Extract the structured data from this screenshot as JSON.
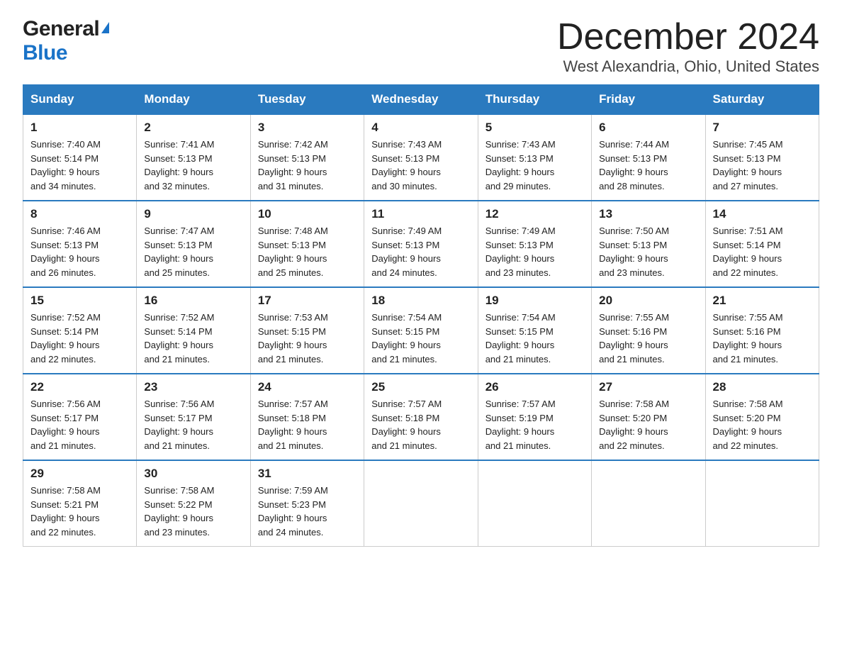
{
  "logo": {
    "general": "General",
    "blue": "Blue"
  },
  "title": "December 2024",
  "location": "West Alexandria, Ohio, United States",
  "days_of_week": [
    "Sunday",
    "Monday",
    "Tuesday",
    "Wednesday",
    "Thursday",
    "Friday",
    "Saturday"
  ],
  "weeks": [
    [
      {
        "day": "1",
        "sunrise": "7:40 AM",
        "sunset": "5:14 PM",
        "daylight": "9 hours and 34 minutes."
      },
      {
        "day": "2",
        "sunrise": "7:41 AM",
        "sunset": "5:13 PM",
        "daylight": "9 hours and 32 minutes."
      },
      {
        "day": "3",
        "sunrise": "7:42 AM",
        "sunset": "5:13 PM",
        "daylight": "9 hours and 31 minutes."
      },
      {
        "day": "4",
        "sunrise": "7:43 AM",
        "sunset": "5:13 PM",
        "daylight": "9 hours and 30 minutes."
      },
      {
        "day": "5",
        "sunrise": "7:43 AM",
        "sunset": "5:13 PM",
        "daylight": "9 hours and 29 minutes."
      },
      {
        "day": "6",
        "sunrise": "7:44 AM",
        "sunset": "5:13 PM",
        "daylight": "9 hours and 28 minutes."
      },
      {
        "day": "7",
        "sunrise": "7:45 AM",
        "sunset": "5:13 PM",
        "daylight": "9 hours and 27 minutes."
      }
    ],
    [
      {
        "day": "8",
        "sunrise": "7:46 AM",
        "sunset": "5:13 PM",
        "daylight": "9 hours and 26 minutes."
      },
      {
        "day": "9",
        "sunrise": "7:47 AM",
        "sunset": "5:13 PM",
        "daylight": "9 hours and 25 minutes."
      },
      {
        "day": "10",
        "sunrise": "7:48 AM",
        "sunset": "5:13 PM",
        "daylight": "9 hours and 25 minutes."
      },
      {
        "day": "11",
        "sunrise": "7:49 AM",
        "sunset": "5:13 PM",
        "daylight": "9 hours and 24 minutes."
      },
      {
        "day": "12",
        "sunrise": "7:49 AM",
        "sunset": "5:13 PM",
        "daylight": "9 hours and 23 minutes."
      },
      {
        "day": "13",
        "sunrise": "7:50 AM",
        "sunset": "5:13 PM",
        "daylight": "9 hours and 23 minutes."
      },
      {
        "day": "14",
        "sunrise": "7:51 AM",
        "sunset": "5:14 PM",
        "daylight": "9 hours and 22 minutes."
      }
    ],
    [
      {
        "day": "15",
        "sunrise": "7:52 AM",
        "sunset": "5:14 PM",
        "daylight": "9 hours and 22 minutes."
      },
      {
        "day": "16",
        "sunrise": "7:52 AM",
        "sunset": "5:14 PM",
        "daylight": "9 hours and 21 minutes."
      },
      {
        "day": "17",
        "sunrise": "7:53 AM",
        "sunset": "5:15 PM",
        "daylight": "9 hours and 21 minutes."
      },
      {
        "day": "18",
        "sunrise": "7:54 AM",
        "sunset": "5:15 PM",
        "daylight": "9 hours and 21 minutes."
      },
      {
        "day": "19",
        "sunrise": "7:54 AM",
        "sunset": "5:15 PM",
        "daylight": "9 hours and 21 minutes."
      },
      {
        "day": "20",
        "sunrise": "7:55 AM",
        "sunset": "5:16 PM",
        "daylight": "9 hours and 21 minutes."
      },
      {
        "day": "21",
        "sunrise": "7:55 AM",
        "sunset": "5:16 PM",
        "daylight": "9 hours and 21 minutes."
      }
    ],
    [
      {
        "day": "22",
        "sunrise": "7:56 AM",
        "sunset": "5:17 PM",
        "daylight": "9 hours and 21 minutes."
      },
      {
        "day": "23",
        "sunrise": "7:56 AM",
        "sunset": "5:17 PM",
        "daylight": "9 hours and 21 minutes."
      },
      {
        "day": "24",
        "sunrise": "7:57 AM",
        "sunset": "5:18 PM",
        "daylight": "9 hours and 21 minutes."
      },
      {
        "day": "25",
        "sunrise": "7:57 AM",
        "sunset": "5:18 PM",
        "daylight": "9 hours and 21 minutes."
      },
      {
        "day": "26",
        "sunrise": "7:57 AM",
        "sunset": "5:19 PM",
        "daylight": "9 hours and 21 minutes."
      },
      {
        "day": "27",
        "sunrise": "7:58 AM",
        "sunset": "5:20 PM",
        "daylight": "9 hours and 22 minutes."
      },
      {
        "day": "28",
        "sunrise": "7:58 AM",
        "sunset": "5:20 PM",
        "daylight": "9 hours and 22 minutes."
      }
    ],
    [
      {
        "day": "29",
        "sunrise": "7:58 AM",
        "sunset": "5:21 PM",
        "daylight": "9 hours and 22 minutes."
      },
      {
        "day": "30",
        "sunrise": "7:58 AM",
        "sunset": "5:22 PM",
        "daylight": "9 hours and 23 minutes."
      },
      {
        "day": "31",
        "sunrise": "7:59 AM",
        "sunset": "5:23 PM",
        "daylight": "9 hours and 24 minutes."
      },
      null,
      null,
      null,
      null
    ]
  ],
  "labels": {
    "sunrise": "Sunrise:",
    "sunset": "Sunset:",
    "daylight": "Daylight:"
  }
}
